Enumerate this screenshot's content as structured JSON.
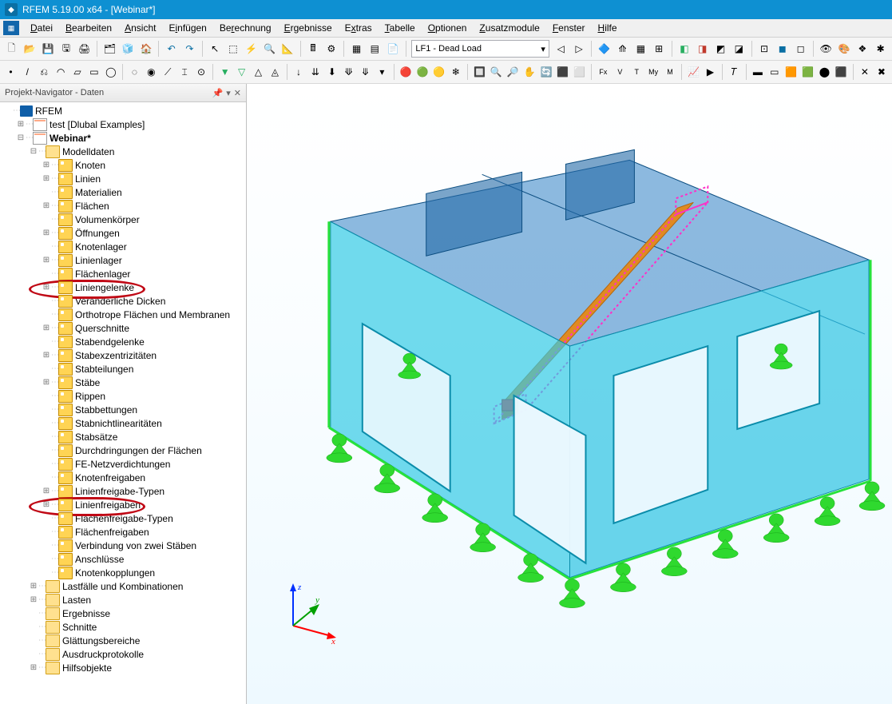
{
  "window": {
    "title": "RFEM 5.19.00 x64 - [Webinar*]"
  },
  "menus": [
    "Datei",
    "Bearbeiten",
    "Ansicht",
    "Einfügen",
    "Berechnung",
    "Ergebnisse",
    "Extras",
    "Tabelle",
    "Optionen",
    "Zusatzmodule",
    "Fenster",
    "Hilfe"
  ],
  "loadcase": {
    "label": "LF1 - Dead Load"
  },
  "navigator": {
    "title": "Projekt-Navigator - Daten",
    "root": "RFEM",
    "projects": [
      {
        "label": "test [Dlubal Examples]",
        "bold": false
      },
      {
        "label": "Webinar*",
        "bold": true
      }
    ],
    "modeldata": "Modelldaten",
    "items": [
      "Knoten",
      "Linien",
      "Materialien",
      "Flächen",
      "Volumenkörper",
      "Öffnungen",
      "Knotenlager",
      "Linienlager",
      "Flächenlager",
      "Liniengelenke",
      "Veränderliche Dicken",
      "Orthotrope Flächen und Membranen",
      "Querschnitte",
      "Stabendgelenke",
      "Stabexzentrizitäten",
      "Stabteilungen",
      "Stäbe",
      "Rippen",
      "Stabbettungen",
      "Stabnichtlinearitäten",
      "Stabsätze",
      "Durchdringungen der Flächen",
      "FE-Netzverdichtungen",
      "Knotenfreigaben",
      "Linienfreigabe-Typen",
      "Linienfreigaben",
      "Flächenfreigabe-Typen",
      "Flächenfreigaben",
      "Verbindung von zwei Stäben",
      "Anschlüsse",
      "Knotenkopplungen"
    ],
    "highlight": [
      9,
      25
    ],
    "after": [
      "Lastfälle und Kombinationen",
      "Lasten",
      "Ergebnisse",
      "Schnitte",
      "Glättungsbereiche",
      "Ausdruckprotokolle",
      "Hilfsobjekte"
    ]
  },
  "axes": {
    "x": "x",
    "y": "y",
    "z": "z"
  }
}
